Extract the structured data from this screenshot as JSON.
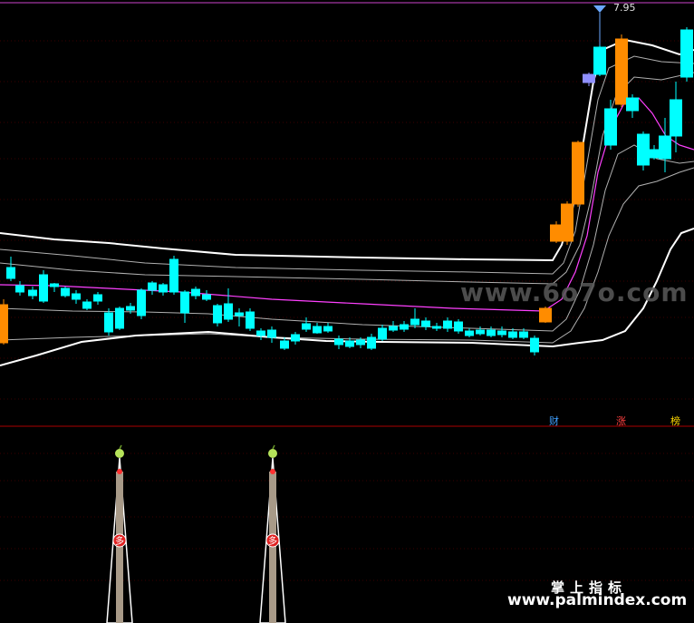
{
  "chart": {
    "max_price_label": "7.95",
    "event_tags": [
      "财",
      "涨",
      "榜"
    ],
    "colors": {
      "up_candle": "#ff3030",
      "down_candle": "#00ffff",
      "limit_up": "#ff8c00",
      "top_candle": "#9090ff",
      "band_outer": "#ffffff",
      "band_inner": "#b0b0b0",
      "mid_line": "#ff40ff",
      "grid": "#3a0000"
    }
  },
  "indicator": {
    "marker_fruit_icon": "apple-icon",
    "marker_text": "多"
  },
  "watermarks": {
    "top": "www.6o7o.com",
    "cn": "掌上指标",
    "bottom": "www.palmindex.com"
  }
}
